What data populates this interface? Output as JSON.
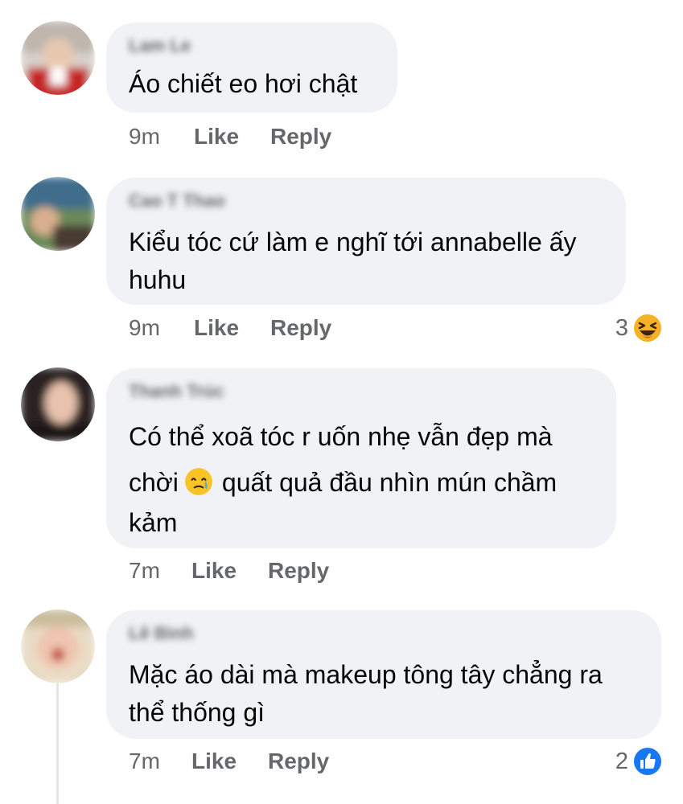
{
  "comments": [
    {
      "author": "Lam Le",
      "text": [
        "Áo chiết eo hơi chật"
      ],
      "time": "9m",
      "like": "Like",
      "reply": "Reply"
    },
    {
      "author": "Cao T Thao",
      "text": [
        "Kiểu tóc cứ làm e nghĩ tới annabelle ấy",
        "huhu"
      ],
      "time": "9m",
      "like": "Like",
      "reply": "Reply",
      "reaction": {
        "count": "3",
        "icon": "laughing-emoji-icon"
      }
    },
    {
      "author": "Thanh Trúc",
      "text": [
        "Có thể xoã tóc r uốn nhẹ vẫn đẹp mà",
        "chời",
        "quất quả đầu nhìn mún chầm",
        "kảm"
      ],
      "time": "7m",
      "like": "Like",
      "reply": "Reply",
      "inline_emoji": "crying-smile-emoji-icon"
    },
    {
      "author": "Lê Bình",
      "text": [
        "Mặc áo dài mà makeup tông tây chẳng ra",
        "thể thống gì"
      ],
      "time": "7m",
      "like": "Like",
      "reply": "Reply",
      "reaction": {
        "count": "2",
        "icon": "thumbs-up-icon"
      }
    }
  ],
  "colors": {
    "bubble": "#f0f2f5",
    "meta": "#65676b",
    "text": "#050505",
    "like_blue": "#1877f2",
    "emoji_yellow": "#f7b125"
  }
}
